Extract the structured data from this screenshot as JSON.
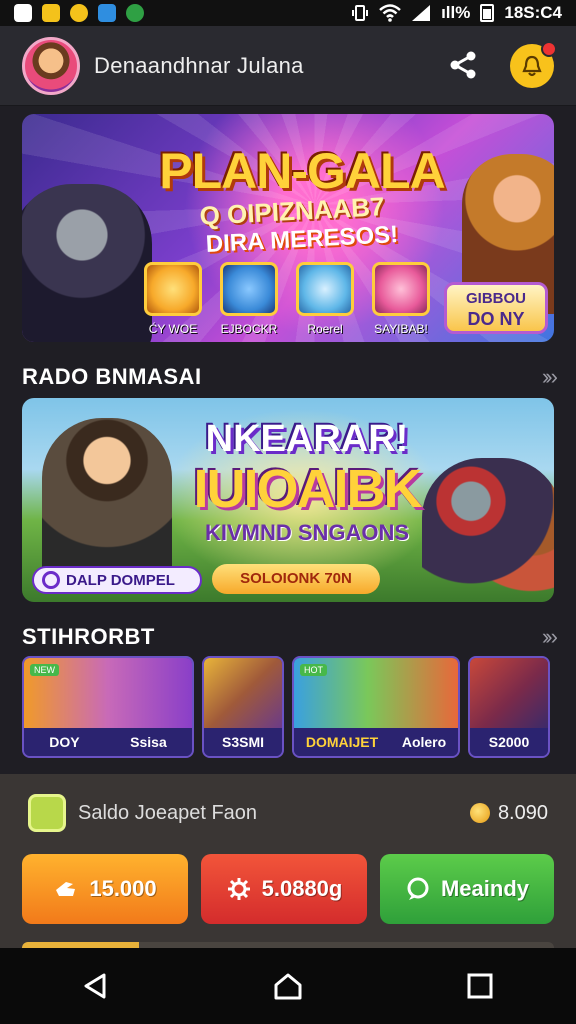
{
  "status_bar": {
    "signal_text": "ıll%",
    "time": "18S:C4",
    "icons": [
      "app-icon-1",
      "app-icon-2",
      "app-icon-3",
      "app-icon-4",
      "app-icon-5"
    ]
  },
  "header": {
    "username": "Denaandhnar Julana",
    "share_icon": "share-icon",
    "notification_icon": "bell-icon"
  },
  "hero": {
    "title": "PLAN-GALA",
    "subtitle_line1": "Q OIPIZNAAB7",
    "subtitle_line2": "DIRA MERESOS!",
    "tiles": [
      {
        "label": "ĆY WOE",
        "color": "#f7a92a"
      },
      {
        "label": "EJBOCKR",
        "color": "#3a8ad8"
      },
      {
        "label": "Roerel",
        "color": "#5fb7e8"
      },
      {
        "label": "SAYIBAB!",
        "color": "#e85a9a"
      }
    ],
    "button_line1": "GIBBOU",
    "button_line2": "DO NY"
  },
  "section1": {
    "title": "RADO BNMASAI",
    "arrow": "›› ›"
  },
  "promo": {
    "title_line1": "NKEARAR!",
    "title_line2": "IUIOAIBK",
    "subtitle": "KIVMND SNGAONS",
    "badge_label": "DALP DOMPEL",
    "button_label": "SOLOIONK 70N"
  },
  "section2": {
    "title": "STIHRORBT",
    "arrow": "›› ›"
  },
  "game_cards": [
    {
      "labels": [
        "DOY",
        "Ssisa"
      ],
      "tag": "NEW",
      "colors": [
        "#f09a2a",
        "#8a3fc8"
      ]
    },
    {
      "labels": [
        "S3SMI"
      ],
      "tag": "",
      "colors": [
        "#e8b43a",
        "#6a3a8a"
      ]
    },
    {
      "labels": [
        "DOMAIJET",
        "Aolero"
      ],
      "tag": "HOT",
      "colors": [
        "#3aa0e0",
        "#e8683a"
      ]
    },
    {
      "labels": [
        "S2000"
      ],
      "tag": "",
      "colors": [
        "#c8483a",
        "#3a2a6a"
      ]
    }
  ],
  "wallet": {
    "label": "Saldo Joeapet Faon",
    "balance": "8.090"
  },
  "actions": [
    {
      "label": "15.000",
      "icon": "hand-icon",
      "color_a": "#ffb22e",
      "color_b": "#f27a1a"
    },
    {
      "label": "5.0880g",
      "icon": "gear-icon",
      "color_a": "#f2553a",
      "color_b": "#d42c2c"
    },
    {
      "label": "Meaindy",
      "icon": "chat-icon",
      "color_a": "#5ccc4a",
      "color_b": "#2fa03a"
    }
  ],
  "nav": {
    "back_icon": "back-icon",
    "home_icon": "home-icon",
    "recents_icon": "recents-icon"
  }
}
